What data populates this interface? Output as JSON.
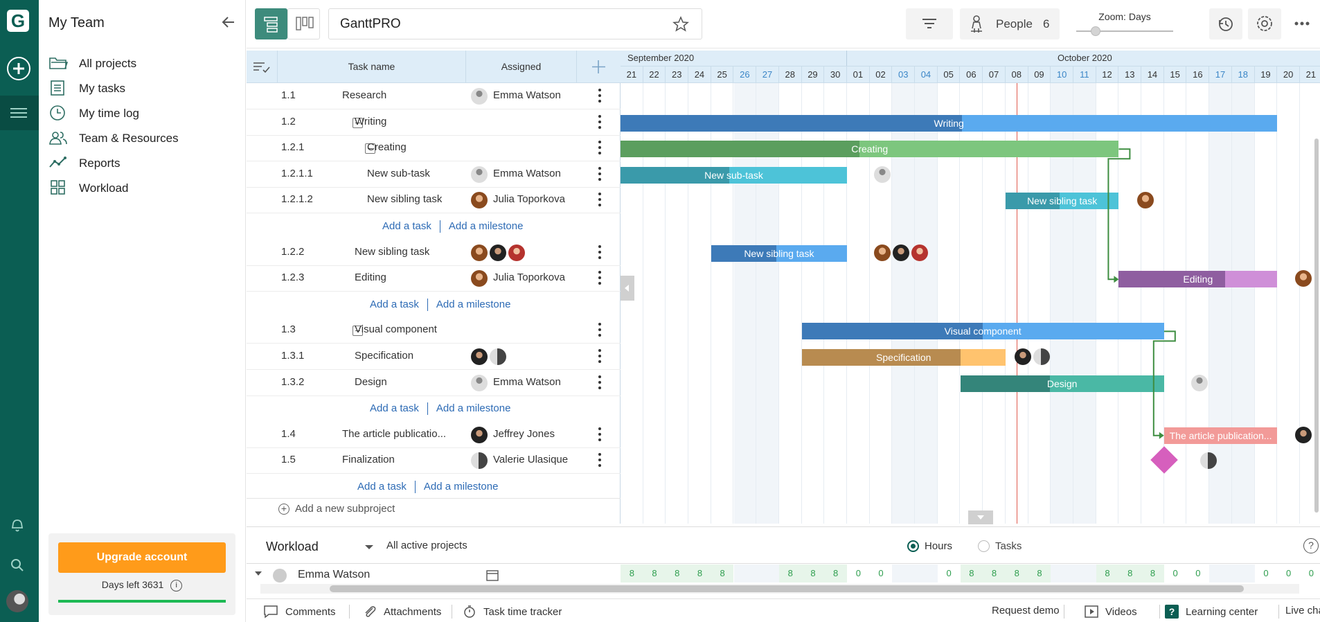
{
  "app": {
    "logo_letter": "G"
  },
  "nav": {
    "title": "My Team",
    "items": [
      {
        "label": "All projects",
        "icon": "folder-icon"
      },
      {
        "label": "My tasks",
        "icon": "checklist-icon"
      },
      {
        "label": "My time log",
        "icon": "clock-icon"
      },
      {
        "label": "Team & Resources",
        "icon": "people-icon"
      },
      {
        "label": "Reports",
        "icon": "chart-line-icon"
      },
      {
        "label": "Workload",
        "icon": "grid-icon"
      }
    ],
    "upgrade_label": "Upgrade account",
    "days_left": "Days left 3631"
  },
  "toolbar": {
    "project_title": "GanttPRO",
    "people_label": "People",
    "people_count": "6",
    "zoom_label": "Zoom: Days",
    "zoom_level": 0.2
  },
  "grid": {
    "col_task": "Task name",
    "col_assigned": "Assigned",
    "add_task": "Add a task",
    "add_milestone": "Add a milestone",
    "add_subproject": "Add a new subproject"
  },
  "rows": [
    {
      "num": "1.1",
      "name": "Research",
      "assignee": "Emma Watson"
    },
    {
      "num": "1.2",
      "name": "Writing",
      "assignee": ""
    },
    {
      "num": "1.2.1",
      "name": "Creating",
      "assignee": ""
    },
    {
      "num": "1.2.1.1",
      "name": "New sub-task",
      "assignee": "Emma Watson"
    },
    {
      "num": "1.2.1.2",
      "name": "New sibling task",
      "assignee": "Julia Toporkova"
    },
    {
      "num": "1.2.2",
      "name": "New sibling task",
      "assignee": ""
    },
    {
      "num": "1.2.3",
      "name": "Editing",
      "assignee": "Julia Toporkova"
    },
    {
      "num": "1.3",
      "name": "Visual component",
      "assignee": ""
    },
    {
      "num": "1.3.1",
      "name": "Specification",
      "assignee": ""
    },
    {
      "num": "1.3.2",
      "name": "Design",
      "assignee": "Emma Watson"
    },
    {
      "num": "1.4",
      "name": "The article publicatio...",
      "assignee": "Jeffrey Jones"
    },
    {
      "num": "1.5",
      "name": "Finalization",
      "assignee": "Valerie Ulasique"
    }
  ],
  "timeline": {
    "months": [
      "September 2020",
      "October 2020"
    ],
    "days": [
      "21",
      "22",
      "23",
      "24",
      "25",
      "26",
      "27",
      "28",
      "29",
      "30",
      "01",
      "02",
      "03",
      "04",
      "05",
      "06",
      "07",
      "08",
      "09",
      "10",
      "11",
      "12",
      "13",
      "14",
      "15",
      "16",
      "17",
      "18",
      "19",
      "20",
      "21"
    ],
    "weekend_days": [
      5,
      6,
      12,
      13,
      19,
      20,
      26,
      27
    ],
    "today_index": 17.5,
    "bars": [
      {
        "label": "Writing",
        "start": 0,
        "end": 29,
        "progress": 0.52,
        "color": "#5aaaef",
        "dark": "#3d7ab8"
      },
      {
        "label": "Creating",
        "start": 0,
        "end": 22,
        "progress": 0.48,
        "color": "#7dc67e",
        "dark": "#5b9e5e"
      },
      {
        "label": "New sub-task",
        "start": 0,
        "end": 10,
        "progress": 0.48,
        "color": "#4dc3d8",
        "dark": "#3a9aaa"
      },
      {
        "label": "New sibling task",
        "start": 17,
        "end": 22,
        "progress": 0.48,
        "color": "#4dc3d8",
        "dark": "#3a9aaa"
      },
      {
        "label": "New sibling task",
        "start": 4,
        "end": 10,
        "progress": 0.48,
        "color": "#5aaaef",
        "dark": "#3d7ab8"
      },
      {
        "label": "Editing",
        "start": 22,
        "end": 29,
        "progress": 0.67,
        "color": "#cf8fd8",
        "dark": "#8f5ea0"
      },
      {
        "label": "Visual component",
        "start": 8,
        "end": 24,
        "progress": 0.5,
        "color": "#5aaaef",
        "dark": "#3d7ab8"
      },
      {
        "label": "Specification",
        "start": 8,
        "end": 17,
        "progress": 0.78,
        "color": "#ffc36e",
        "dark": "#b88b50"
      },
      {
        "label": "Design",
        "start": 15,
        "end": 24,
        "progress": 0.44,
        "color": "#4ab8a5",
        "dark": "#34857a"
      },
      {
        "label": "The article publication...",
        "start": 24,
        "end": 29,
        "progress": 0.0,
        "color": "#f29a98",
        "dark": "#d87a78"
      }
    ]
  },
  "workload": {
    "title": "Workload",
    "scope": "All active projects",
    "mode_hours": "Hours",
    "mode_tasks": "Tasks",
    "person": "Emma Watson",
    "values": [
      "8",
      "8",
      "8",
      "8",
      "8",
      "",
      "",
      "8",
      "8",
      "8",
      "0",
      "0",
      "",
      "",
      "0",
      "8",
      "8",
      "8",
      "8",
      "",
      "",
      "8",
      "8",
      "8",
      "0",
      "0",
      "",
      "",
      "0",
      "0",
      "0"
    ]
  },
  "footer": {
    "comments": "Comments",
    "attachments": "Attachments",
    "tracker": "Task time tracker",
    "demo": "Request demo",
    "videos": "Videos",
    "learning": "Learning center",
    "chat": "Live chat"
  },
  "colors": {
    "brand": "#0b5e53",
    "accent": "#ff9b1a",
    "today": "#e05a4e",
    "link": "#2d6bb5"
  }
}
